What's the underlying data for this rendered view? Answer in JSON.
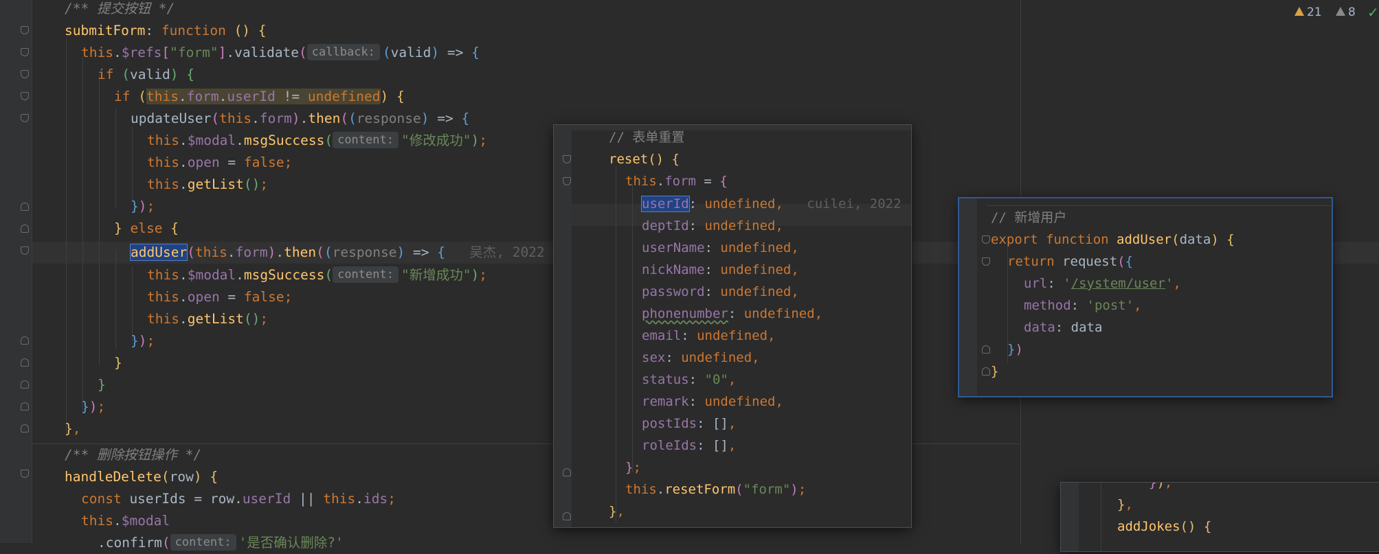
{
  "status": {
    "warnings": "21",
    "weak_warnings": "8"
  },
  "blame": {
    "add_user_line": "吴杰, 2022",
    "popup_userid_line": "cuilei, 2022"
  },
  "editor": {
    "comment_submit": "/** 提交按钮 */",
    "submit_fn": "submitForm",
    "hint_callback": "callback:",
    "hint_content": "content:",
    "str_form": "\"form\"",
    "msg_update": "\"修改成功\"",
    "msg_add": "\"新增成功\"",
    "comment_delete": "/** 删除按钮操作 */",
    "delete_fn": "handleDelete",
    "confirm_text": "'是否确认删除?'"
  },
  "popup_reset": {
    "comment": "// 表单重置",
    "fn": "reset",
    "fields": [
      {
        "name": "userId",
        "value": "undefined"
      },
      {
        "name": "deptId",
        "value": "undefined"
      },
      {
        "name": "userName",
        "value": "undefined"
      },
      {
        "name": "nickName",
        "value": "undefined"
      },
      {
        "name": "password",
        "value": "undefined"
      },
      {
        "name": "phonenumber",
        "value": "undefined"
      },
      {
        "name": "email",
        "value": "undefined"
      },
      {
        "name": "sex",
        "value": "undefined"
      },
      {
        "name": "status",
        "value": "\"0\""
      },
      {
        "name": "remark",
        "value": "undefined"
      },
      {
        "name": "postIds",
        "value": "[]"
      },
      {
        "name": "roleIds",
        "value": "[]"
      }
    ],
    "reset_arg": "\"form\""
  },
  "popup_adduser": {
    "comment": "// 新增用户",
    "fn": "addUser",
    "param": "data",
    "url": "/system/user",
    "method": "'post'",
    "data_key": "data",
    "data_val": "data"
  },
  "popup_jokes": {
    "fn": "addJokes"
  }
}
